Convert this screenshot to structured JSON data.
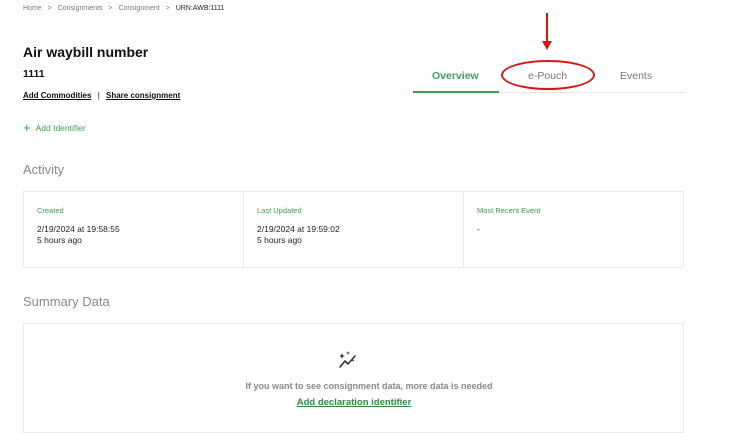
{
  "breadcrumb": {
    "items": [
      "Home",
      "Consignments",
      "Consignment"
    ],
    "separator": ">",
    "current": "URN:AWB:1111"
  },
  "header": {
    "title": "Air waybill number",
    "number": "1111",
    "add_commodities": "Add Commodities",
    "divider": "|",
    "share_consignment": "Share consignment",
    "add_identifier": "Add Identifier"
  },
  "tabs": [
    {
      "label": "Overview",
      "active": true
    },
    {
      "label": "e-Pouch",
      "active": false
    },
    {
      "label": "Events",
      "active": false
    }
  ],
  "activity": {
    "heading": "Activity",
    "columns": [
      {
        "label": "Created",
        "date": "2/19/2024 at 19:58:55",
        "ago": "5 hours ago"
      },
      {
        "label": "Last Updated",
        "date": "2/19/2024 at 19:59:02",
        "ago": "5 hours ago"
      },
      {
        "label": "Most Recent Event",
        "date": "-",
        "ago": ""
      }
    ]
  },
  "summary": {
    "heading": "Summary Data",
    "icon": "sparkle-chart-icon",
    "message": "If you want to see consignment data, more data is needed",
    "action": "Add declaration identifier"
  },
  "colors": {
    "accent": "#3f9d55",
    "annotation": "#d51616"
  }
}
